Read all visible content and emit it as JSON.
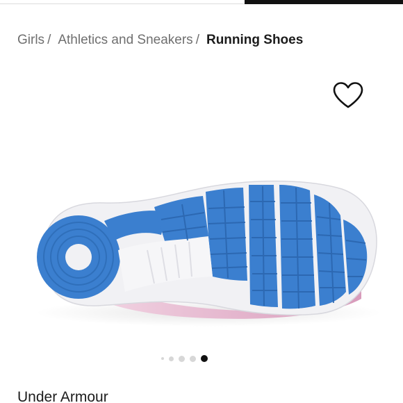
{
  "breadcrumb": {
    "items": [
      {
        "label": "Girls"
      },
      {
        "label": "Athletics and Sneakers"
      },
      {
        "label": "Running Shoes"
      }
    ],
    "separator": "/"
  },
  "gallery": {
    "image_subject": "shoe-sole",
    "slide_count": 5,
    "active_slide_index": 4
  },
  "product": {
    "brand": "Under Armour"
  },
  "icons": {
    "wishlist": "heart-outline-icon"
  },
  "colors": {
    "sole_blue": "#3b7fcf",
    "sole_white": "#f1f1f4",
    "upper_pink": "#d9a8c0",
    "active_dot": "#111111"
  }
}
